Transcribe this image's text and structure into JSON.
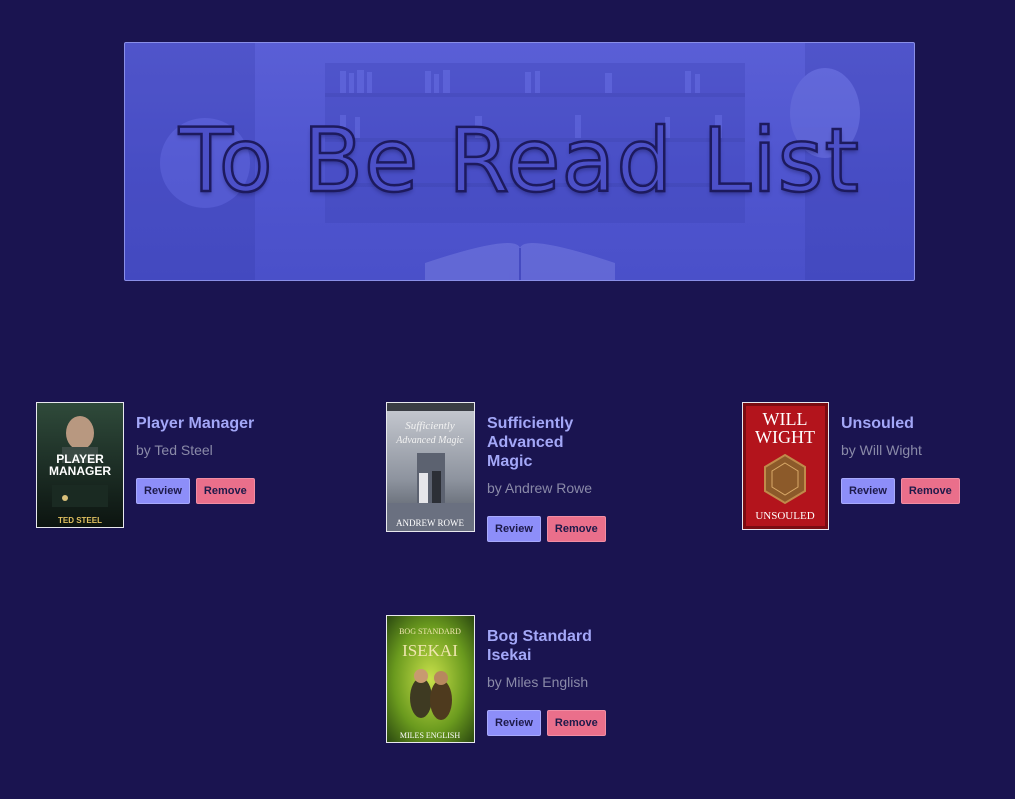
{
  "header": {
    "title": "To Be Read List"
  },
  "colors": {
    "background": "#1a1450",
    "banner": "#5056cf",
    "title_link": "#a3a7f7",
    "author_text": "#8a8aa8",
    "review_button": "#8d8ef9",
    "remove_button": "#ea6f8b"
  },
  "books": [
    {
      "title": "Player Manager",
      "author": "by Ted Steel",
      "review_label": "Review",
      "remove_label": "Remove",
      "cover_text": [
        "PLAYER",
        "MANAGER",
        "TED STEEL"
      ]
    },
    {
      "title": "Sufficiently Advanced Magic",
      "author": "by Andrew Rowe",
      "review_label": "Review",
      "remove_label": "Remove",
      "cover_text": [
        "Sufficiently",
        "Advanced Magic",
        "ANDREW ROWE"
      ]
    },
    {
      "title": "Unsouled",
      "author": "by Will Wight",
      "review_label": "Review",
      "remove_label": "Remove",
      "cover_text": [
        "WILL",
        "WIGHT",
        "UNSOULED"
      ]
    },
    {
      "title": "Bog Standard Isekai",
      "author": "by Miles English",
      "review_label": "Review",
      "remove_label": "Remove",
      "cover_text": [
        "BOG STANDARD",
        "ISEKAI",
        "MILES ENGLISH"
      ]
    }
  ]
}
